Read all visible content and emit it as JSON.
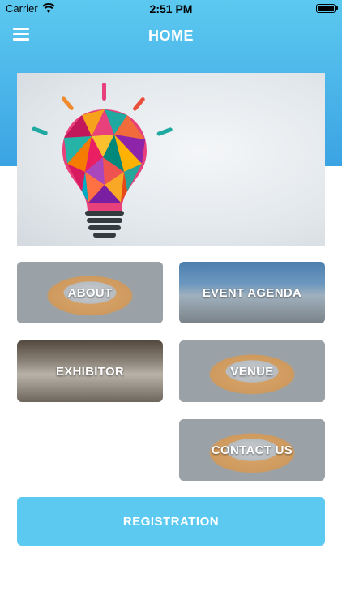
{
  "status_bar": {
    "carrier": "Carrier",
    "time": "2:51 PM"
  },
  "nav": {
    "title": "HOME",
    "menu_icon": "hamburger-menu-icon"
  },
  "hero": {
    "image": "lightbulb-illustration"
  },
  "tiles": [
    {
      "label": "ABOUT"
    },
    {
      "label": "EVENT AGENDA"
    },
    {
      "label": "EXHIBITOR"
    },
    {
      "label": "VENUE"
    },
    {
      "label": "CONTACT US"
    }
  ],
  "registration": {
    "label": "REGISTRATION"
  },
  "colors": {
    "header_top": "#5cc9f0",
    "header_bottom": "#3ba3e3",
    "button": "#5ccaf0"
  }
}
